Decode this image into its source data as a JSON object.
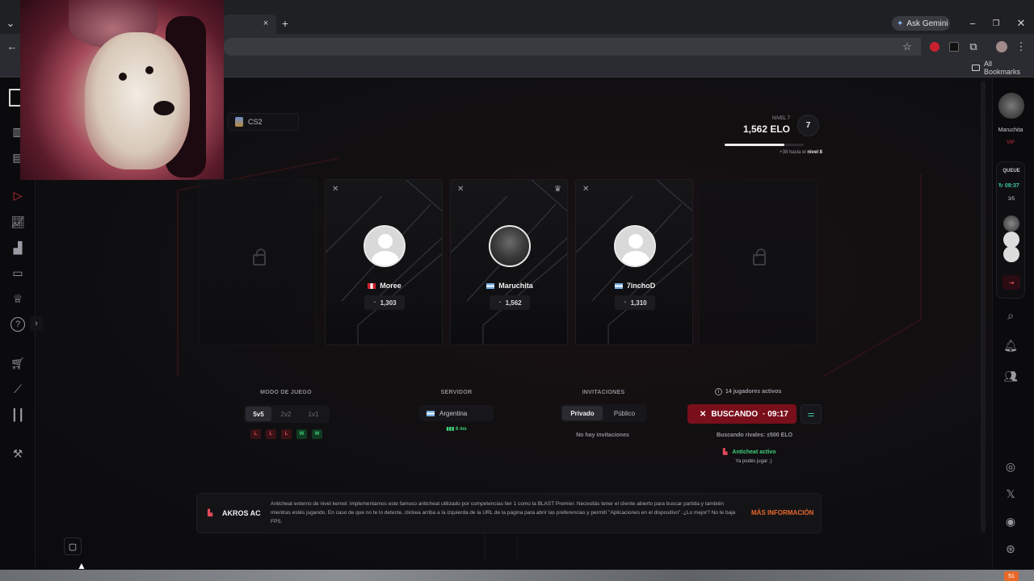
{
  "browser": {
    "new_tab_symbol": "+",
    "tab_close_symbol": "×",
    "gemini_label": "Ask Gemini",
    "bookmarks_label": "All Bookmarks",
    "window_controls": [
      "−",
      "❐",
      "✕"
    ]
  },
  "sidebar": {
    "expand_symbol": "›",
    "items": [
      "play-icon",
      "stats-icon",
      "ranking-icon",
      "video-icon",
      "trophy-icon",
      "help-icon",
      "cart-icon",
      "knife-icon",
      "audio-icon",
      "tools-icon"
    ]
  },
  "header": {
    "game_label": "CS2",
    "level_label": "NIVEL 7",
    "elo_value": "1,562 ELO",
    "level_badge": "7",
    "progress_fraction": 0.75,
    "progress_text_prefix": "+38 hacia el",
    "progress_text_target": "nivel 8"
  },
  "lobby": {
    "players": [
      {
        "name": "Moree",
        "flag": "pe",
        "elo": "1,303",
        "photo": false,
        "leader": false
      },
      {
        "name": "Maruchita",
        "flag": "ar",
        "elo": "1,562",
        "photo": true,
        "leader": true
      },
      {
        "name": "7inchoD",
        "flag": "ar",
        "elo": "1,310",
        "photo": false,
        "leader": false
      }
    ]
  },
  "controls": {
    "mode_label": "MODO DE JUEGO",
    "modes": [
      "5v5",
      "2v2",
      "1v1"
    ],
    "recent_results": [
      "L",
      "L",
      "L",
      "W",
      "W"
    ],
    "server_label": "SERVIDOR",
    "server_value": "Argentina",
    "ping": "6 ms",
    "invites_label": "INVITACIONES",
    "invite_tabs": [
      "Privado",
      "Público"
    ],
    "no_invites": "No hay invitaciones",
    "active_players": "14 jugadores activos",
    "search_button": "BUSCANDO",
    "search_timer": "· 09:17",
    "search_rivals": "Buscando rivales: ±500 ELO",
    "anticheat_status": "Anticheat activo",
    "ready_text": "Ya podés jugar ;)"
  },
  "banner": {
    "title": "AKROS AC",
    "text": "Anticheat externo de nivel kernel: implementamos este famoso anticheat utilizado por competencias tier 1 como la BLAST Premier. Necesitás tener el cliente abierto para buscar partida y también mientras estés jugando. En caso de que no te lo detecte, clickea arriba a la izquierda de la URL de la pagina para abrir las preferencias y permití \"Aplicaciones en el dispositivo\". ¿Lo mejor? No te baja FPS.",
    "link": "MÁS INFORMACIÓN"
  },
  "rightbar": {
    "username": "Maruchita",
    "tier": "VIP",
    "queue_label": "QUEUE",
    "queue_timer": "09:37",
    "queue_count": "3/5"
  },
  "taskbar": {
    "badge": "51"
  },
  "colors": {
    "accent_red": "#7a0f1c",
    "win_green": "#3fd27a",
    "loss_red": "#e24a5a",
    "link_orange": "#e8682a",
    "teal": "#3ec7a3"
  }
}
